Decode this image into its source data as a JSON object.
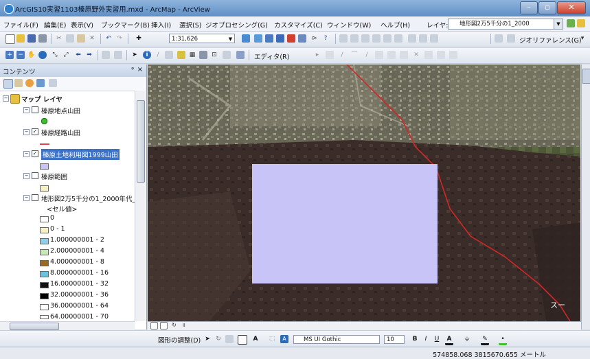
{
  "window": {
    "title": "ArcGIS10実習1103榛原野外実習用.mxd - ArcMap - ArcView"
  },
  "menu": [
    "ファイル(F)",
    "編集(E)",
    "表示(V)",
    "ブックマーク(B)",
    "挿入(I)",
    "選択(S)",
    "ジオプロセシング(G)",
    "カスタマイズ(C)",
    "ウィンドウ(W)",
    "ヘルプ(H)"
  ],
  "layer_selector": {
    "label": "レイヤ:",
    "value": "地形図2万5千分の1_2000"
  },
  "toolbar": {
    "scale": "1:31,626",
    "georef_label": "ジオリファレンス(G)",
    "editor_label": "エディタ(R)"
  },
  "toc": {
    "title": "コンテンツ",
    "group": "マップ レイヤ",
    "layers": [
      {
        "name": "榛原地点山田",
        "checked": false,
        "symbol": "green-dot"
      },
      {
        "name": "榛原経路山田",
        "checked": true,
        "symbol": "red-line"
      },
      {
        "name": "榛原土地利用図1999山田",
        "checked": true,
        "symbol": "lavender-fill",
        "selected": true
      },
      {
        "name": "榛原範囲",
        "checked": false,
        "symbol": "pale-yellow-fill"
      },
      {
        "name": "地形図2万5千分の1_2000年代_",
        "checked": false,
        "symbol": "raster"
      }
    ],
    "cell_value_header": "<セル値>",
    "legend": [
      {
        "label": "0",
        "color": "#ffffff"
      },
      {
        "label": "0 - 1",
        "color": "#f4f0c0"
      },
      {
        "label": "1.000000001 - 2",
        "color": "#8ed0e8"
      },
      {
        "label": "2.000000001 - 4",
        "color": "#c8e6b8"
      },
      {
        "label": "4.000000001 - 8",
        "color": "#9a6a20"
      },
      {
        "label": "8.000000001 - 16",
        "color": "#6cc0e0"
      },
      {
        "label": "16.00000001 - 32",
        "color": "#111111"
      },
      {
        "label": "32.00000001 - 36",
        "color": "#000000"
      },
      {
        "label": "36.00000001 - 64",
        "color": "#ffffff"
      },
      {
        "label": "64.00000001 - 70",
        "color": "#ffffff"
      }
    ]
  },
  "map": {
    "overlay_color": "#c8c4f8",
    "route_color": "#d02828",
    "tag_text": "スー"
  },
  "drawing": {
    "label": "図形の調整(D)",
    "font": "MS UI Gothic",
    "size": "10"
  },
  "status": {
    "coords": "574858.068  3815670.655 メートル"
  }
}
